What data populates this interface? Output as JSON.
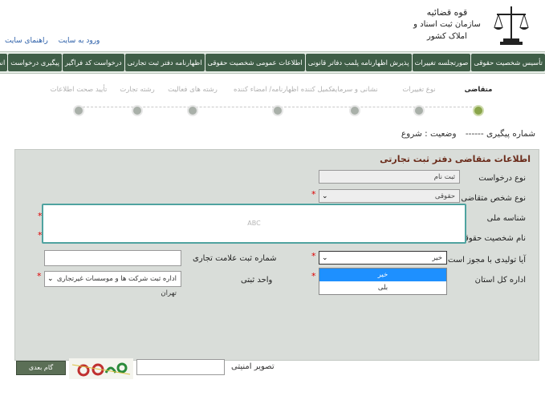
{
  "header": {
    "org_line1": "قوه قضائیه",
    "org_line2": "سازمان ثبت اسناد و املاک کشور",
    "links": [
      "ورود به سایت",
      "راهنمای سایت"
    ]
  },
  "nav": {
    "items": [
      "تأسیس شخصیت حقوقی",
      "صورتجلسه تغییرات",
      "پذیرش اظهارنامه پلمب دفاتر قانونی",
      "اطلاعات عمومی شخصیت حقوقی",
      "اظهارنامه دفتر ثبت تجارتی",
      "درخواست کد فراگیر",
      "پیگیری درخواست",
      "انصراف از درخواست"
    ]
  },
  "steps": [
    {
      "label": "متقاضی",
      "active": true
    },
    {
      "label": "نوع تغییرات",
      "active": false
    },
    {
      "label": "نشانی و سرمایه",
      "active": false
    },
    {
      "label": "تکمیل کننده اظهارنامه/ امضاء کننده",
      "active": false
    },
    {
      "label": "رشته های فعالیت",
      "active": false
    },
    {
      "label": "رشته تجارت",
      "active": false
    },
    {
      "label": "تأیید صحت اطلاعات",
      "active": false
    }
  ],
  "tracking": {
    "number_label": "شماره پیگیری ------",
    "status_label": "وضعیت : شروع"
  },
  "form": {
    "title": "اطلاعات متقاضی دفتر ثبت تجارتی",
    "request_type_label": "نوع درخواست",
    "request_type_value": "ثبت نام",
    "applicant_type_label": "نوع شخص متقاضی",
    "applicant_type_value": "حقوقی",
    "national_id_label": "شناسه ملی",
    "legal_name_label": "نام شخصیت حقوقی",
    "producer_license_label": "آیا تولیدی با مجوز است",
    "producer_license_value": "خیر",
    "dropdown_options": [
      "خیر",
      "بلی"
    ],
    "trademark_reg_label": "شماره ثبت علامت تجاری",
    "province_office_label": "اداره کل استان",
    "registration_unit_label": "واحد ثبتی",
    "registration_unit_value": "اداره ثبت شرکت ها و موسسات غیرتجاری تهران",
    "required_mark": "*"
  },
  "popup": {
    "text": "ABC"
  },
  "bottom": {
    "captcha_label": "تصویر امنیتی",
    "next_button": "گام بعدی"
  }
}
